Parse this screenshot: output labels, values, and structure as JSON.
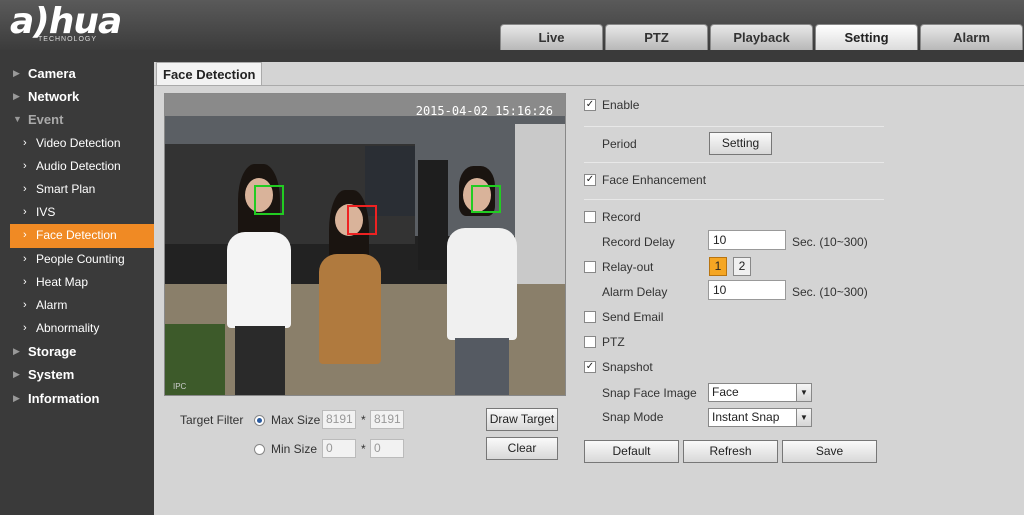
{
  "logo": {
    "brand": "a)hua",
    "sub": "TECHNOLOGY"
  },
  "tabs": [
    {
      "label": "Live"
    },
    {
      "label": "PTZ"
    },
    {
      "label": "Playback"
    },
    {
      "label": "Setting"
    },
    {
      "label": "Alarm"
    }
  ],
  "sidebar": {
    "camera": "Camera",
    "network": "Network",
    "event": "Event",
    "subitems": [
      "Video Detection",
      "Audio Detection",
      "Smart Plan",
      "IVS",
      "Face Detection",
      "People Counting",
      "Heat Map",
      "Alarm",
      "Abnormality"
    ],
    "storage": "Storage",
    "system": "System",
    "information": "Information"
  },
  "page": {
    "title": "Face Detection"
  },
  "video": {
    "timestamp": "2015-04-02 15:16:26",
    "overlay": "IPC"
  },
  "filter": {
    "label": "Target Filter",
    "max_label": "Max Size",
    "max_w": "8191",
    "max_h": "8191",
    "min_label": "Min Size",
    "min_w": "0",
    "min_h": "0",
    "sep": "*",
    "draw_target": "Draw Target",
    "clear": "Clear"
  },
  "settings": {
    "enable": "Enable",
    "period": "Period",
    "period_btn": "Setting",
    "face_enhancement": "Face Enhancement",
    "record": "Record",
    "record_delay": "Record Delay",
    "record_delay_value": "10",
    "record_delay_unit": "Sec. (10~300)",
    "relay_out": "Relay-out",
    "relay_1": "1",
    "relay_2": "2",
    "alarm_delay": "Alarm Delay",
    "alarm_delay_value": "10",
    "alarm_delay_unit": "Sec. (10~300)",
    "send_email": "Send Email",
    "ptz": "PTZ",
    "snapshot": "Snapshot",
    "snap_face_image": "Snap Face Image",
    "snap_face_value": "Face",
    "snap_mode": "Snap Mode",
    "snap_mode_value": "Instant Snap",
    "check_mark": "✓"
  },
  "buttons": {
    "default": "Default",
    "refresh": "Refresh",
    "save": "Save"
  },
  "colors": {
    "accent": "#f08a24",
    "face_box_green": "#22cc22",
    "face_box_red": "#ee2222"
  }
}
